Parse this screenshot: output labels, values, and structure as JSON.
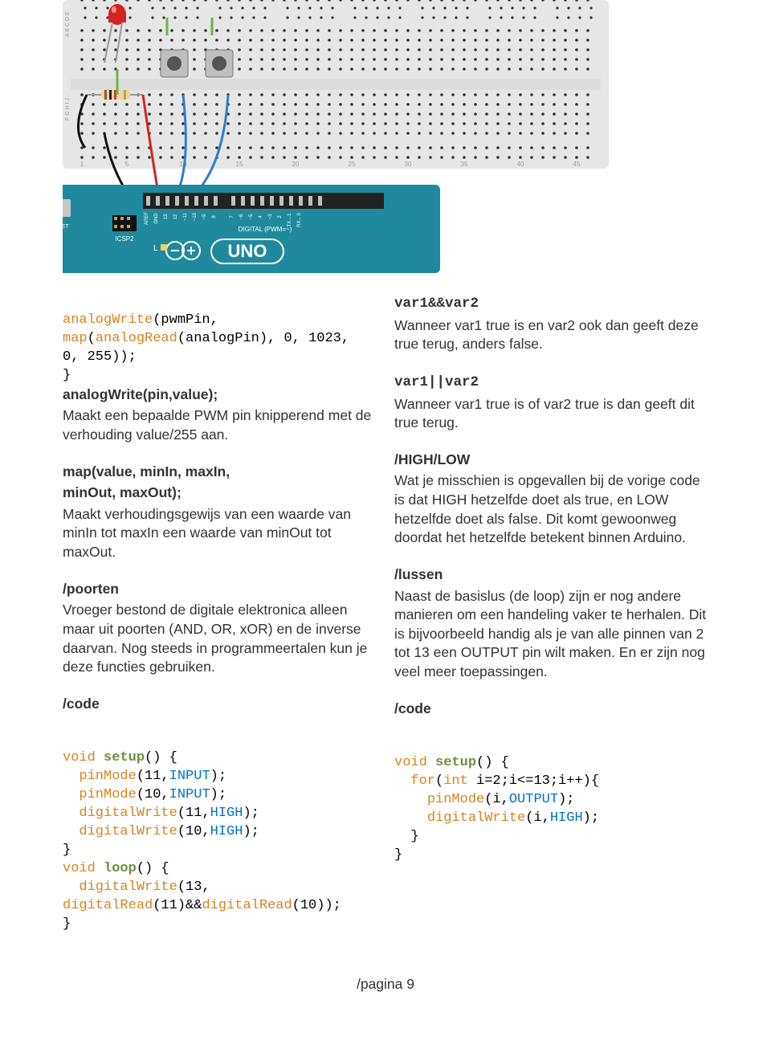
{
  "left": {
    "code1": {
      "l1a": "analogWrite",
      "l1b": "(pwmPin,",
      "l2a": "map",
      "l2b": "(",
      "l2c": "analogRead",
      "l2d": "(analogPin), 0, 1023,",
      "l3": "0, 255));",
      "l4": "}"
    },
    "analogWrite": {
      "title": "analogWrite(pin,value);",
      "p1": "Maakt een bepaalde PWM pin knipperend met de verhouding value/255 aan."
    },
    "map": {
      "title1": "map(value, minIn, maxIn,",
      "title2": "minOut, maxOut);",
      "p1": "Maakt verhoudingsgewijs van een waarde van minIn tot maxIn een waarde van minOut tot maxOut."
    },
    "poorten": {
      "title": "/poorten",
      "p1": "Vroeger bestond de digitale elektronica alleen maar uit poorten (AND, OR, xOR) en de inverse daarvan. Nog steeds in programmeertalen kun je deze functies gebruiken."
    },
    "codeH": {
      "title": "/code"
    },
    "code2": {
      "l1a": "void",
      "l1b": "setup",
      "l1c": "() {",
      "l2a": "pinMode",
      "l2b": "(11,",
      "l2c": "INPUT",
      "l2d": ");",
      "l3a": "pinMode",
      "l3b": "(10,",
      "l3c": "INPUT",
      "l3d": ");",
      "l4a": "digitalWrite",
      "l4b": "(11,",
      "l4c": "HIGH",
      "l4d": ");",
      "l5a": "digitalWrite",
      "l5b": "(10,",
      "l5c": "HIGH",
      "l5d": ");",
      "l6": "}",
      "l7a": "void",
      "l7b": "loop",
      "l7c": "() {",
      "l8a": "digitalWrite",
      "l8b": "(13,",
      "l9a": "digitalRead",
      "l9b": "(11)&&",
      "l9c": "digitalRead",
      "l9d": "(10));",
      "l10": "}"
    }
  },
  "right": {
    "var1and": {
      "title": "var1&&var2",
      "p1": "Wanneer var1 true is en var2 ook dan geeft deze true terug, anders false."
    },
    "var1or": {
      "title": "var1||var2",
      "p1": "Wanneer var1 true is of var2 true is dan geeft dit true terug."
    },
    "highlow": {
      "title": "/HIGH/LOW",
      "p1": "Wat je misschien is opgevallen bij de vorige code is dat HIGH hetzelfde doet als true, en LOW hetzelfde doet als false. Dit komt gewoonweg doordat het hetzelfde betekent binnen Arduino."
    },
    "lussen": {
      "title": "/lussen",
      "p1": "Naast de basislus (de loop) zijn er nog andere manieren om een handeling vaker te herhalen. Dit is bijvoorbeeld handig als je van alle pinnen van 2 tot 13 een OUTPUT pin wilt maken. En er zijn nog veel meer toepassingen."
    },
    "codeH": {
      "title": "/code"
    },
    "code3": {
      "l1a": "void",
      "l1b": "setup",
      "l1c": "() {",
      "l2a": "for",
      "l2b": "(",
      "l2c": "int",
      "l2d": " i=2;i<=13;i++){",
      "l3a": "pinMode",
      "l3b": "(i,",
      "l3c": "OUTPUT",
      "l3d": ");",
      "l4a": "digitalWrite",
      "l4b": "(i,",
      "l4c": "HIGH",
      "l4d": ");",
      "l5": "}",
      "l6": "}"
    }
  },
  "footer": "/pagina 9"
}
